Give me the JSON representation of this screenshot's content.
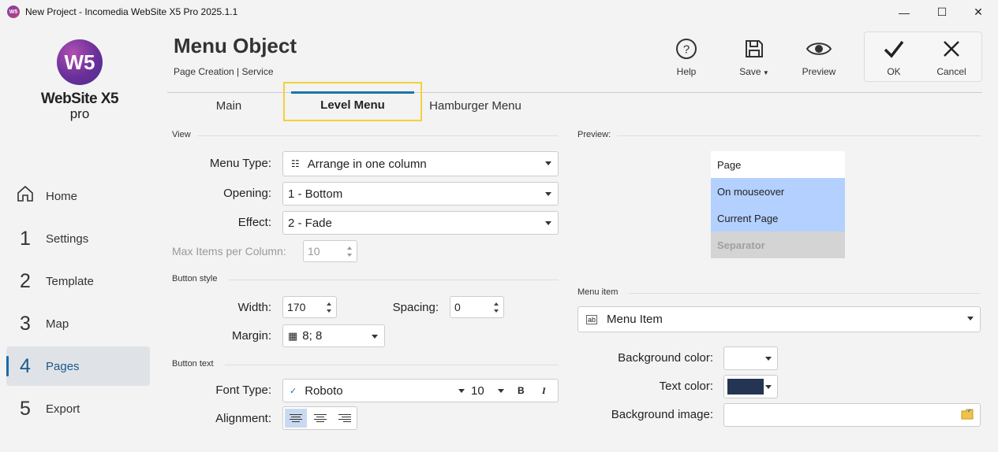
{
  "window": {
    "title": "New Project - Incomedia WebSite X5 Pro 2025.1.1",
    "app_icon": "W5"
  },
  "logo": {
    "mark": "W5",
    "name": "WebSite X5",
    "edition": "pro"
  },
  "sidebar": {
    "items": [
      {
        "num": "",
        "label": "Home",
        "icon": "home-icon"
      },
      {
        "num": "1",
        "label": "Settings"
      },
      {
        "num": "2",
        "label": "Template"
      },
      {
        "num": "3",
        "label": "Map"
      },
      {
        "num": "4",
        "label": "Pages",
        "active": true
      },
      {
        "num": "5",
        "label": "Export"
      }
    ]
  },
  "header": {
    "title": "Menu Object",
    "breadcrumb": "Page Creation | Service",
    "tools": {
      "help": "Help",
      "save": "Save",
      "preview": "Preview",
      "ok": "OK",
      "cancel": "Cancel"
    }
  },
  "tabs": [
    {
      "label": "Main"
    },
    {
      "label": "Level Menu",
      "active": true
    },
    {
      "label": "Hamburger Menu"
    }
  ],
  "view": {
    "section": "View",
    "menu_type_label": "Menu Type:",
    "menu_type_value": "Arrange in one column",
    "opening_label": "Opening:",
    "opening_value": "1 - Bottom",
    "effect_label": "Effect:",
    "effect_value": "2 - Fade",
    "max_items_label": "Max Items per Column:",
    "max_items_value": "10"
  },
  "button_style": {
    "section": "Button style",
    "width_label": "Width:",
    "width_value": "170",
    "spacing_label": "Spacing:",
    "spacing_value": "0",
    "margin_label": "Margin:",
    "margin_value": "8; 8"
  },
  "button_text": {
    "section": "Button text",
    "font_type_label": "Font Type:",
    "font_value": "Roboto",
    "font_size": "10",
    "bold": "B",
    "italic": "I",
    "alignment_label": "Alignment:"
  },
  "preview": {
    "section": "Preview:",
    "items": [
      "Page",
      "On mouseover",
      "Current Page",
      "Separator"
    ],
    "colors": {
      "page_bg": "#ffffff",
      "hover_bg": "#b3d0ff",
      "separator_bg": "#d4d4d4",
      "separator_text": "#a0a0a0"
    }
  },
  "menu_item": {
    "section": "Menu item",
    "selected": "Menu Item",
    "bg_color_label": "Background color:",
    "bg_color": "#ffffff",
    "text_color_label": "Text color:",
    "text_color": "#243554",
    "bg_image_label": "Background image:"
  },
  "colors": {
    "accent": "#1a75a8",
    "highlight": "#f2d13a"
  }
}
